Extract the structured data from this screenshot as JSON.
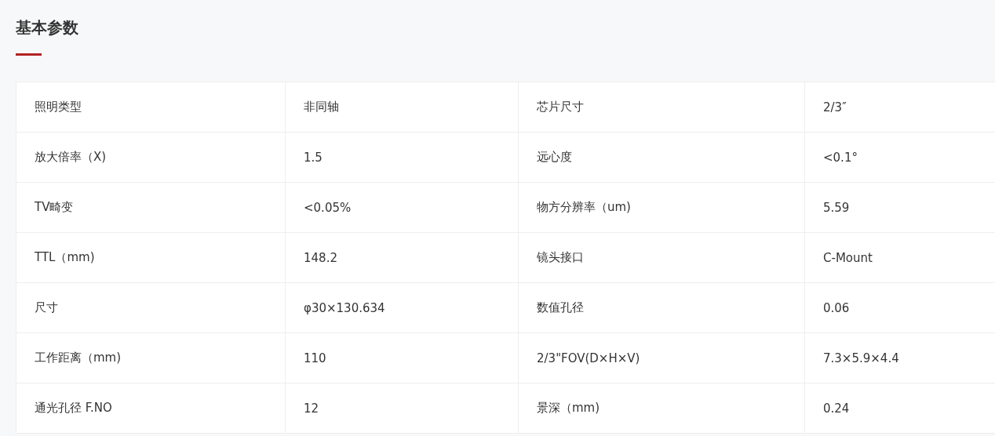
{
  "title": "基本参数",
  "table": {
    "rows": [
      {
        "cells": [
          "照明类型",
          "非同轴",
          "芯片尺寸",
          "2/3″"
        ]
      },
      {
        "cells": [
          "放大倍率（X)",
          "1.5",
          "远心度",
          "<0.1°"
        ]
      },
      {
        "cells": [
          "TV畸变",
          "<0.05%",
          "物方分辨率（um)",
          "5.59"
        ]
      },
      {
        "cells": [
          "TTL（mm)",
          "148.2",
          "镜头接口",
          "C-Mount"
        ]
      },
      {
        "cells": [
          "尺寸",
          "φ30×130.634",
          "数值孔径",
          "0.06"
        ]
      },
      {
        "cells": [
          "工作距离（mm)",
          "110",
          "2/3\"FOV(D×H×V)",
          "7.3×5.9×4.4"
        ]
      },
      {
        "cells": [
          "通光孔径 F.NO",
          "12",
          "景深（mm)",
          "0.24"
        ]
      }
    ]
  }
}
